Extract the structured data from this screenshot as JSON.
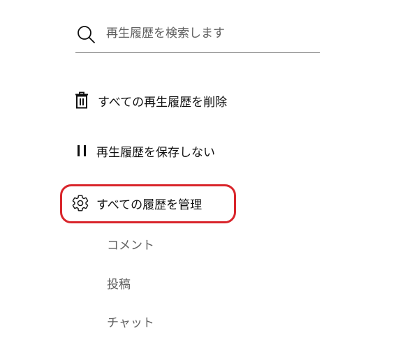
{
  "search": {
    "placeholder": "再生履歴を検索します",
    "icon": "search-icon"
  },
  "actions": [
    {
      "label": "すべての再生履歴を削除",
      "icon": "trash-icon"
    },
    {
      "label": "再生履歴を保存しない",
      "icon": "pause-icon"
    },
    {
      "label": "すべての履歴を管理",
      "icon": "gear-icon",
      "highlighted": true
    }
  ],
  "manage_links": [
    {
      "label": "コメント"
    },
    {
      "label": "投稿"
    },
    {
      "label": "チャット"
    }
  ],
  "colors": {
    "highlight": "#d9252b",
    "text": "#0f0f0f",
    "secondary_text": "#606060",
    "underline": "#8a8a8a"
  }
}
